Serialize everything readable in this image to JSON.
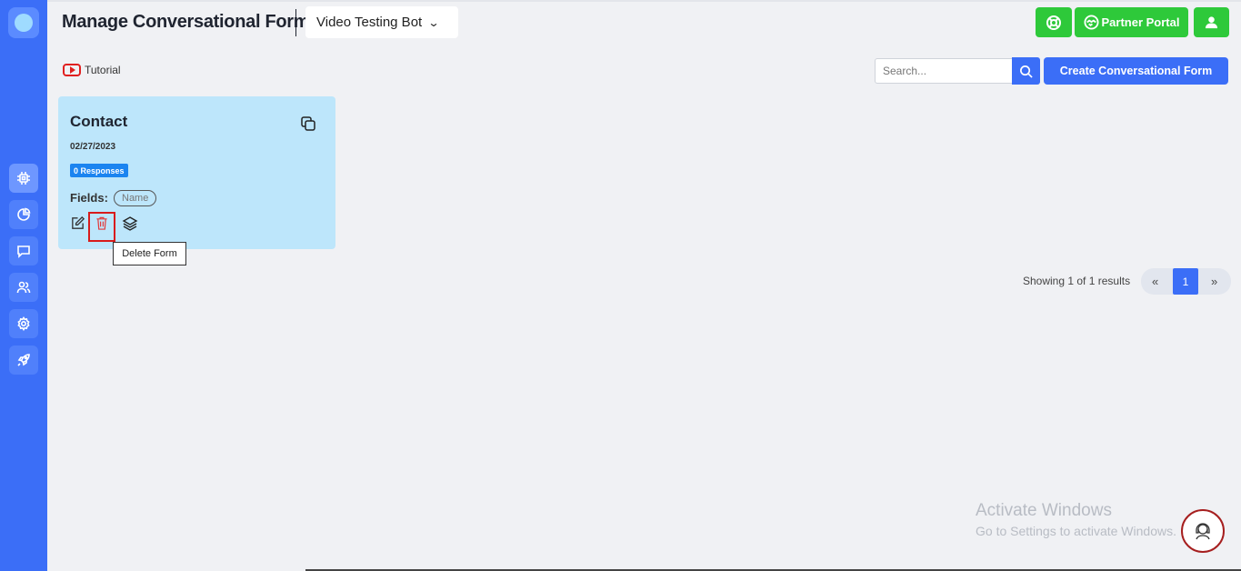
{
  "header": {
    "title": "Manage Conversational Forms",
    "bot_selector": "Video Testing Bot",
    "partner_portal": "Partner Portal"
  },
  "sidebar": {
    "items": [
      {
        "icon": "chip-icon",
        "active": true
      },
      {
        "icon": "pie-chart-icon",
        "active": false
      },
      {
        "icon": "chat-icon",
        "active": false
      },
      {
        "icon": "users-icon",
        "active": false
      },
      {
        "icon": "settings-icon",
        "active": false
      },
      {
        "icon": "rocket-icon",
        "active": false
      }
    ]
  },
  "toolbar": {
    "tutorial_label": "Tutorial",
    "search_placeholder": "Search...",
    "create_button": "Create Conversational Form"
  },
  "forms": [
    {
      "title": "Contact",
      "date": "02/27/2023",
      "responses": "0 Responses",
      "fields_label": "Fields:",
      "fields": [
        "Name"
      ]
    }
  ],
  "tooltip": "Delete Form",
  "pagination": {
    "summary": "Showing 1 of 1 results",
    "prev": "«",
    "current": "1",
    "next": "»"
  },
  "watermark": {
    "line1": "Activate Windows",
    "line2": "Go to Settings to activate Windows."
  },
  "colors": {
    "sidebar": "#3b6ef7",
    "primary": "#3b6ef7",
    "success": "#2ec93a",
    "card": "#bde6fb",
    "danger": "#d81b1b"
  }
}
